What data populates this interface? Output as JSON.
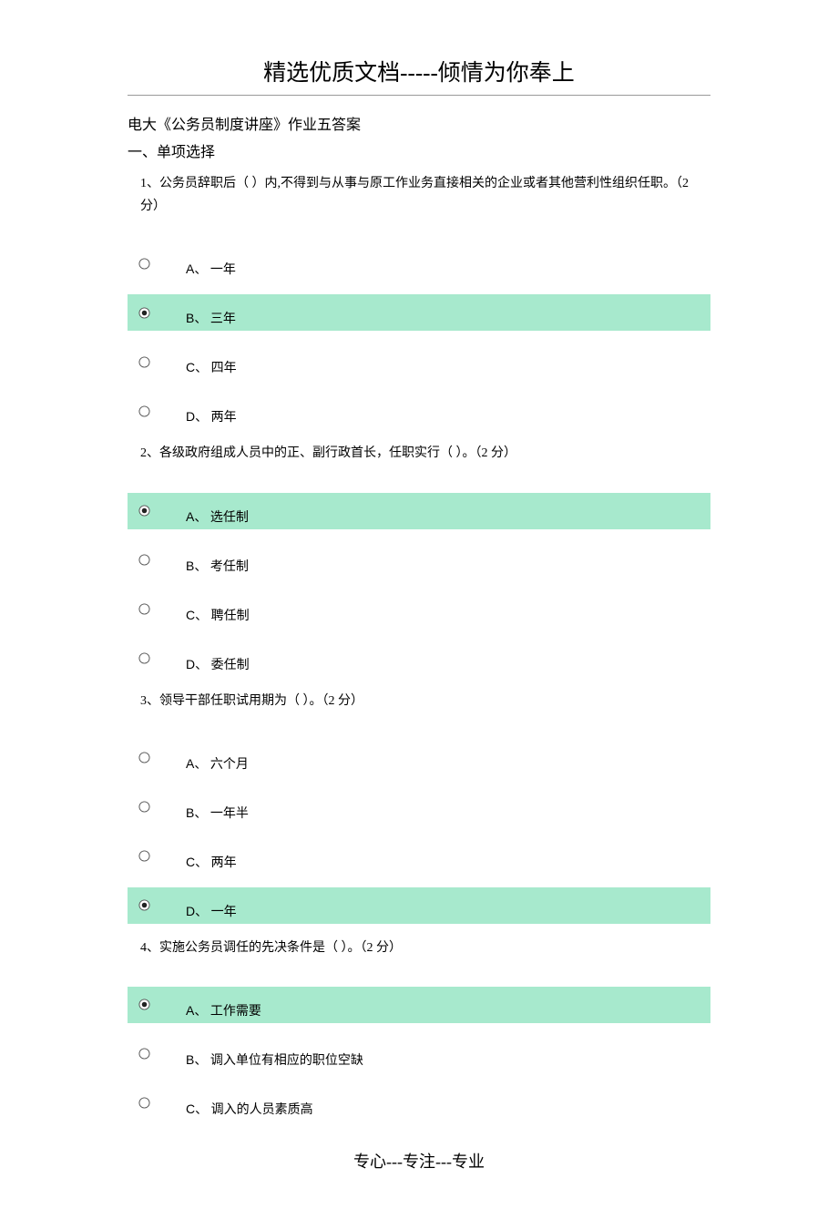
{
  "header": "精选优质文档-----倾情为你奉上",
  "doc_title": "电大《公务员制度讲座》作业五答案",
  "section_title": "一、单项选择",
  "questions": [
    {
      "stem": "1、公务员辞职后（ ）内,不得到与从事与原工作业务直接相关的企业或者其他营利性组织任职。（2 分）",
      "options": [
        {
          "letter": "A、",
          "text": "一年",
          "selected": false
        },
        {
          "letter": "B、",
          "text": "三年",
          "selected": true
        },
        {
          "letter": "C、",
          "text": "四年",
          "selected": false
        },
        {
          "letter": "D、",
          "text": "两年",
          "selected": false
        }
      ]
    },
    {
      "stem": "2、各级政府组成人员中的正、副行政首长，任职实行（ ）。（2 分）",
      "options": [
        {
          "letter": "A、",
          "text": "选任制",
          "selected": true
        },
        {
          "letter": "B、",
          "text": "考任制",
          "selected": false
        },
        {
          "letter": "C、",
          "text": "聘任制",
          "selected": false
        },
        {
          "letter": "D、",
          "text": "委任制",
          "selected": false
        }
      ]
    },
    {
      "stem": "3、领导干部任职试用期为（ ）。（2 分）",
      "options": [
        {
          "letter": "A、",
          "text": "六个月",
          "selected": false
        },
        {
          "letter": "B、",
          "text": "一年半",
          "selected": false
        },
        {
          "letter": "C、",
          "text": "两年",
          "selected": false
        },
        {
          "letter": "D、",
          "text": "一年",
          "selected": true
        }
      ]
    },
    {
      "stem": "4、实施公务员调任的先决条件是（ ）。（2 分）",
      "options": [
        {
          "letter": "A、",
          "text": "工作需要",
          "selected": true
        },
        {
          "letter": "B、",
          "text": "调入单位有相应的职位空缺",
          "selected": false
        },
        {
          "letter": "C、",
          "text": "调入的人员素质高",
          "selected": false
        }
      ]
    }
  ],
  "footer": "专心---专注---专业"
}
